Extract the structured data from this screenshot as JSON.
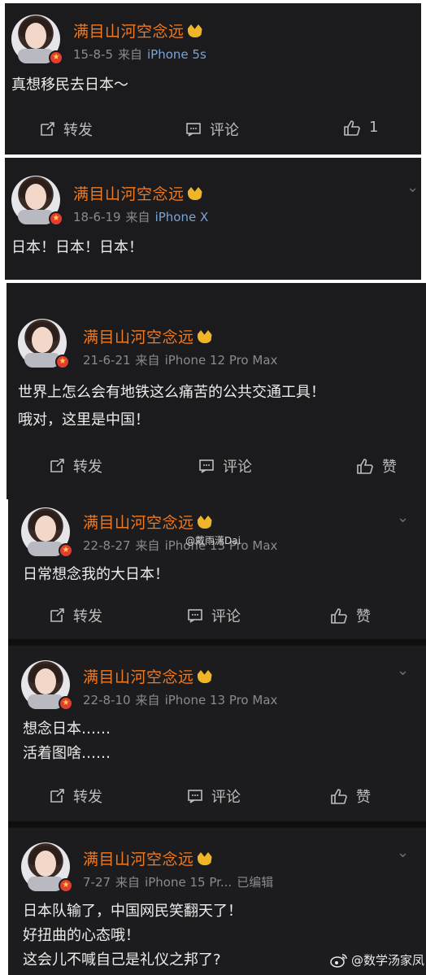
{
  "posts": [
    {
      "username": "满目山河空念远",
      "date": "15-8-5",
      "from_label": "来自",
      "device": "iPhone 5s",
      "lines": [
        "真想移民去日本～"
      ],
      "actions": {
        "repost": "转发",
        "comment": "评论",
        "like": "1"
      }
    },
    {
      "username": "满目山河空念远",
      "date": "18-6-19",
      "from_label": "来自",
      "device": "iPhone X",
      "lines": [
        "日本！日本！日本！"
      ]
    },
    {
      "username": "满目山河空念远",
      "date": "21-6-21",
      "from_label": "来自",
      "device": "iPhone 12 Pro Max",
      "lines": [
        "世界上怎么会有地铁这么痛苦的公共交通工具！",
        "哦对，这里是中国！"
      ],
      "actions": {
        "repost": "转发",
        "comment": "评论",
        "like": "赞"
      }
    },
    {
      "username": "满目山河空念远",
      "date": "22-8-27",
      "from_label": "来自",
      "device": "iPhone 13 Pro Max",
      "lines": [
        "日常想念我的大日本！"
      ],
      "actions": {
        "repost": "转发",
        "comment": "评论",
        "like": "赞"
      }
    },
    {
      "username": "满目山河空念远",
      "date": "22-8-10",
      "from_label": "来自",
      "device": "iPhone 13 Pro Max",
      "lines": [
        "想念日本……",
        "活着图啥……"
      ],
      "actions": {
        "repost": "转发",
        "comment": "评论",
        "like": "赞"
      }
    },
    {
      "username": "满目山河空念远",
      "date": "7-27",
      "from_label": "来自",
      "device": "iPhone 15 Pr...",
      "edited": "已编辑",
      "lines": [
        "日本队输了，中国网民笑翻天了！",
        "好扭曲的心态哦！",
        "这会儿不喊自己是礼仪之邦了?"
      ]
    }
  ],
  "overlay_watermark": "@戴雨潇Dai",
  "corner_watermark": "@数学汤家凤",
  "colors": {
    "username": "#f07a22",
    "device": "#7aa4d6",
    "background": "#1b1b1d"
  },
  "icons": [
    "repost-icon",
    "comment-icon",
    "like-icon",
    "more-chevron-icon",
    "verified-badge-icon",
    "crown-icon",
    "weibo-logo-icon"
  ]
}
